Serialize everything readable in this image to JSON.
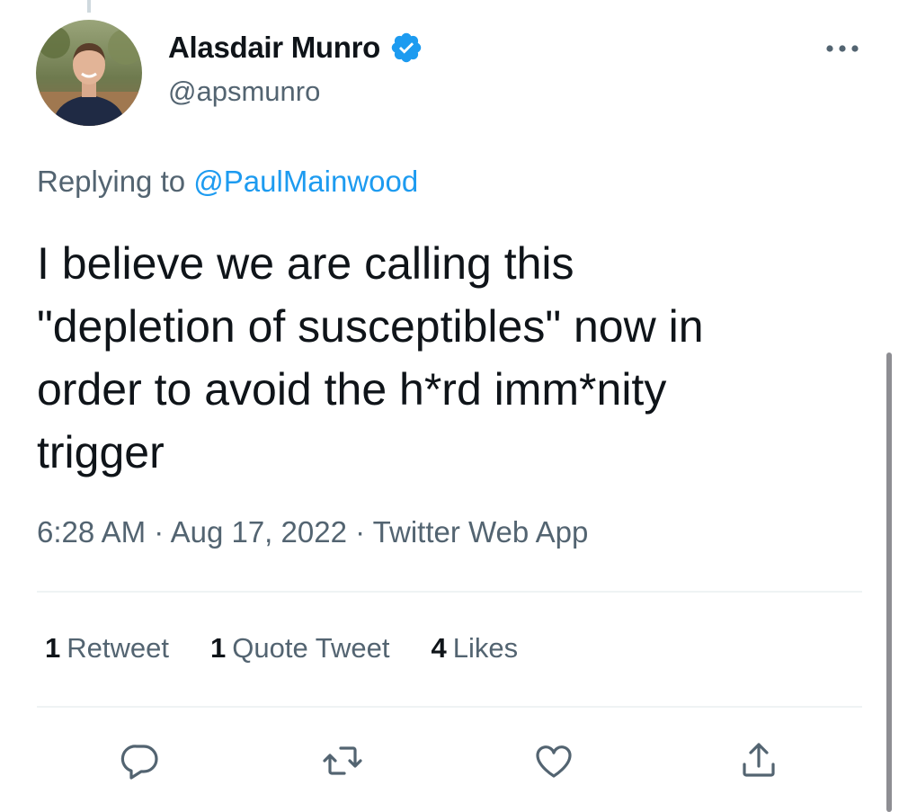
{
  "author": {
    "display_name": "Alasdair Munro",
    "handle": "@apsmunro",
    "verified": true,
    "avatar_icon": "profile-photo"
  },
  "reply": {
    "prefix": "Replying to ",
    "mention": "@PaulMainwood"
  },
  "tweet": {
    "text": "I believe we are calling this\n\"depletion of susceptibles\" now in\norder to avoid the h*rd imm*nity\ntrigger",
    "meta": "6:28 AM · Aug 17, 2022 · Twitter Web App"
  },
  "stats": {
    "retweets": {
      "count": "1",
      "label": "Retweet"
    },
    "quotes": {
      "count": "1",
      "label": "Quote Tweet"
    },
    "likes": {
      "count": "4",
      "label": "Likes"
    }
  },
  "actions": [
    "reply-icon",
    "retweet-icon",
    "like-icon",
    "share-icon"
  ],
  "colors": {
    "accent": "#1d9bf0",
    "text": "#0f1419",
    "secondary": "#536471",
    "divider": "#eff3f4"
  }
}
